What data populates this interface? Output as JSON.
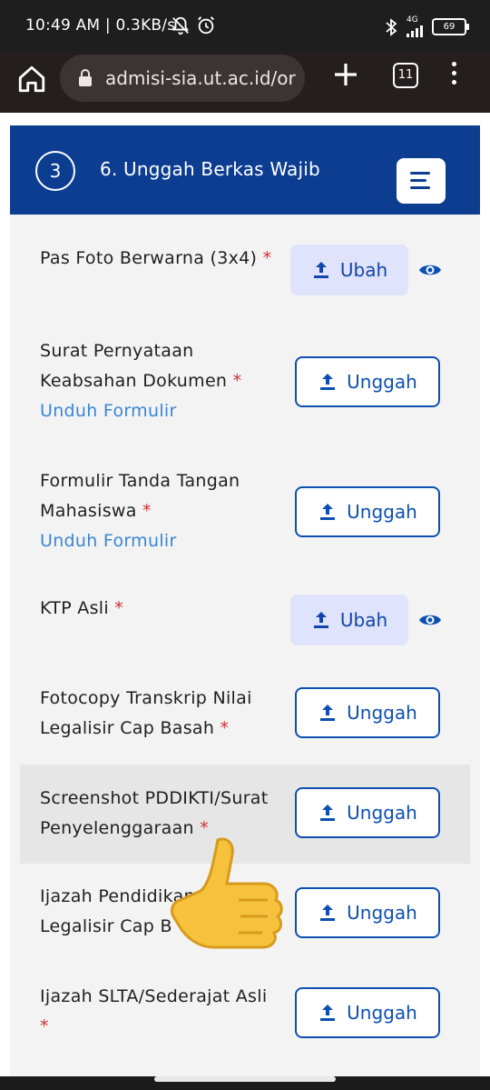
{
  "status_bar": {
    "time": "10:49 AM",
    "speed": "0.3KB/s",
    "network": "4G",
    "battery": "69",
    "icons": [
      "bell-off-icon",
      "alarm-icon",
      "bluetooth-icon",
      "signal-icon"
    ]
  },
  "browser": {
    "url": "admisi-sia.ut.ac.id/or",
    "tab_count": "11"
  },
  "section": {
    "step": "3",
    "title": "6. Unggah Berkas Wajib"
  },
  "documents": [
    {
      "label_lines": [
        "Pas Foto Berwarna (3x4)"
      ],
      "required": "*",
      "link": "",
      "button": "Ubah",
      "state": "uploaded"
    },
    {
      "label_lines": [
        "Surat Pernyataan",
        "Keabsahan Dokumen"
      ],
      "required": "*",
      "link": "Unduh Formulir",
      "button": "Unggah",
      "state": "empty"
    },
    {
      "label_lines": [
        "Formulir Tanda Tangan",
        "Mahasiswa"
      ],
      "required": "*",
      "link": "Unduh Formulir",
      "button": "Unggah",
      "state": "empty"
    },
    {
      "label_lines": [
        "KTP Asli"
      ],
      "required": "*",
      "link": "",
      "button": "Ubah",
      "state": "uploaded"
    },
    {
      "label_lines": [
        "Fotocopy Transkrip Nilai",
        "Legalisir Cap Basah"
      ],
      "required": "*",
      "link": "",
      "button": "Unggah",
      "state": "empty"
    },
    {
      "label_lines": [
        "Screenshot PDDIKTI/Surat",
        "Penyelenggaraan"
      ],
      "required": "*",
      "link": "",
      "button": "Unggah",
      "state": "empty"
    },
    {
      "label_lines": [
        "Ijazah Pendidikan",
        "Legalisir Cap B"
      ],
      "required": "",
      "link": "",
      "button": "Unggah",
      "state": "empty"
    },
    {
      "label_lines": [
        "Ijazah SLTA/Sederajat Asli",
        ""
      ],
      "required": "*",
      "link": "",
      "button": "Unggah",
      "state": "empty"
    }
  ],
  "colors": {
    "header": "#0d3d91",
    "accent": "#0d4fb0",
    "required": "#d32f2f",
    "link": "#3a86d4"
  }
}
